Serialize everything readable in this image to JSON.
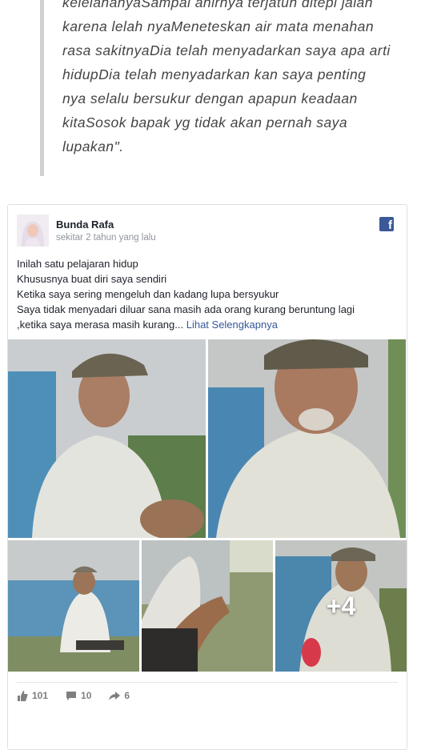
{
  "quote": {
    "lines": [
      "kelelahanyaSampai ahirnya terjatuh ditepi jalan",
      "karena lelah nyaMeneteskan air mata menahan",
      "rasa sakitnyaDia telah menyadarkan saya apa arti",
      "hidupDia telah menyadarkan kan saya penting",
      "nya selalu bersukur dengan apapun keadaan",
      "kitaSosok bapak yg tidak akan pernah saya",
      "lupakan\"."
    ]
  },
  "post": {
    "author": "Bunda Rafa",
    "time": "sekitar 2 tahun yang lalu",
    "lines": [
      "Inilah satu pelajaran hidup",
      "Khususnya buat diri saya sendiri",
      "Ketika saya sering mengeluh dan kadang lupa bersyukur",
      "Saya tidak menyadari diluar sana masih ada orang kurang beruntung lagi",
      ",ketika saya merasa masih kurang..."
    ],
    "see_more": "Lihat Selengkapnya",
    "more_photos": "+4",
    "likes": "101",
    "comments": "10",
    "shares": "6",
    "brand_icon": "facebook-icon",
    "colors": {
      "facebook_blue": "#3b5998",
      "link": "#365899"
    }
  }
}
